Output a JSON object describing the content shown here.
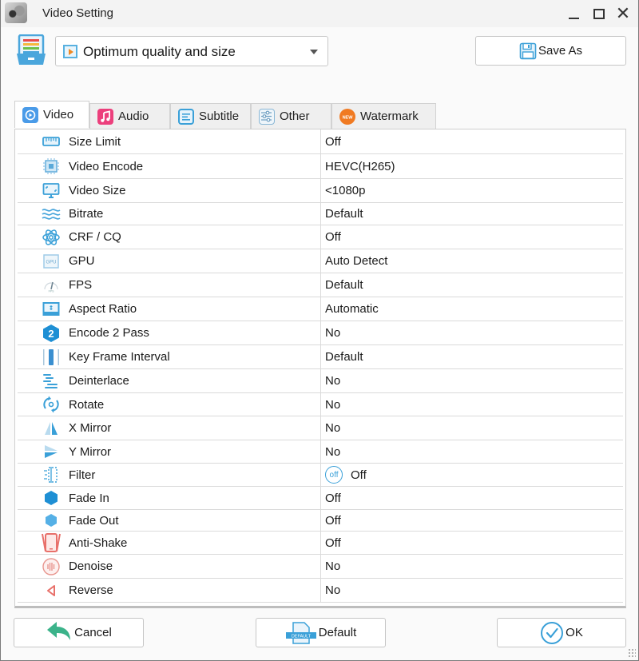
{
  "window": {
    "title": "Video Setting",
    "controls": [
      "minimize",
      "maximize",
      "close"
    ]
  },
  "preset": {
    "selected": "Optimum quality and size",
    "icon": "film-icon"
  },
  "toolbar": {
    "save_as_label": "Save As"
  },
  "tabs": [
    {
      "label": "Video",
      "icon": "video-icon",
      "active": true
    },
    {
      "label": "Audio",
      "icon": "music-icon",
      "active": false
    },
    {
      "label": "Subtitle",
      "icon": "subtitle-icon",
      "active": false
    },
    {
      "label": "Other",
      "icon": "sliders-icon",
      "active": false
    },
    {
      "label": "Watermark",
      "icon": "new-badge-icon",
      "active": false
    }
  ],
  "settings": [
    {
      "label": "Size Limit",
      "value": "Off",
      "icon": "ruler-icon"
    },
    {
      "label": "Video Encode",
      "value": "HEVC(H265)",
      "icon": "chip-icon"
    },
    {
      "label": "Video Size",
      "value": "<1080p",
      "icon": "monitor-icon"
    },
    {
      "label": "Bitrate",
      "value": "Default",
      "icon": "waves-icon"
    },
    {
      "label": "CRF / CQ",
      "value": "Off",
      "icon": "atom-icon"
    },
    {
      "label": "GPU",
      "value": "Auto Detect",
      "icon": "gpu-icon"
    },
    {
      "label": "FPS",
      "value": "Default",
      "icon": "gauge-icon"
    },
    {
      "label": "Aspect Ratio",
      "value": "Automatic",
      "icon": "aspect-ratio-icon"
    },
    {
      "label": "Encode 2 Pass",
      "value": "No",
      "icon": "two-pass-icon"
    },
    {
      "label": "Key Frame Interval",
      "value": "Default",
      "icon": "keyframe-icon"
    },
    {
      "label": "Deinterlace",
      "value": "No",
      "icon": "deinterlace-icon"
    },
    {
      "label": "Rotate",
      "value": "No",
      "icon": "rotate-icon"
    },
    {
      "label": "X Mirror",
      "value": "No",
      "icon": "x-mirror-icon"
    },
    {
      "label": "Y Mirror",
      "value": "No",
      "icon": "y-mirror-icon"
    },
    {
      "label": "Filter",
      "value": "Off",
      "icon": "filter-icon",
      "value_badge": "off"
    },
    {
      "label": "Fade In",
      "value": "Off",
      "icon": "fade-in-icon"
    },
    {
      "label": "Fade Out",
      "value": "Off",
      "icon": "fade-out-icon"
    },
    {
      "label": "Anti-Shake",
      "value": "Off",
      "icon": "phone-shake-icon"
    },
    {
      "label": "Denoise",
      "value": "No",
      "icon": "denoise-icon"
    },
    {
      "label": "Reverse",
      "value": "No",
      "icon": "reverse-icon"
    }
  ],
  "footer": {
    "cancel_label": "Cancel",
    "default_label": "Default",
    "default_icon_text": "DEFAULT",
    "ok_label": "OK"
  },
  "colors": {
    "accent_blue": "#3aa0d8",
    "cancel_green": "#3bb38a",
    "audio_pink": "#ec3f7c",
    "watermark_orange": "#f07a22",
    "anti_shake_red": "#e8706a"
  }
}
